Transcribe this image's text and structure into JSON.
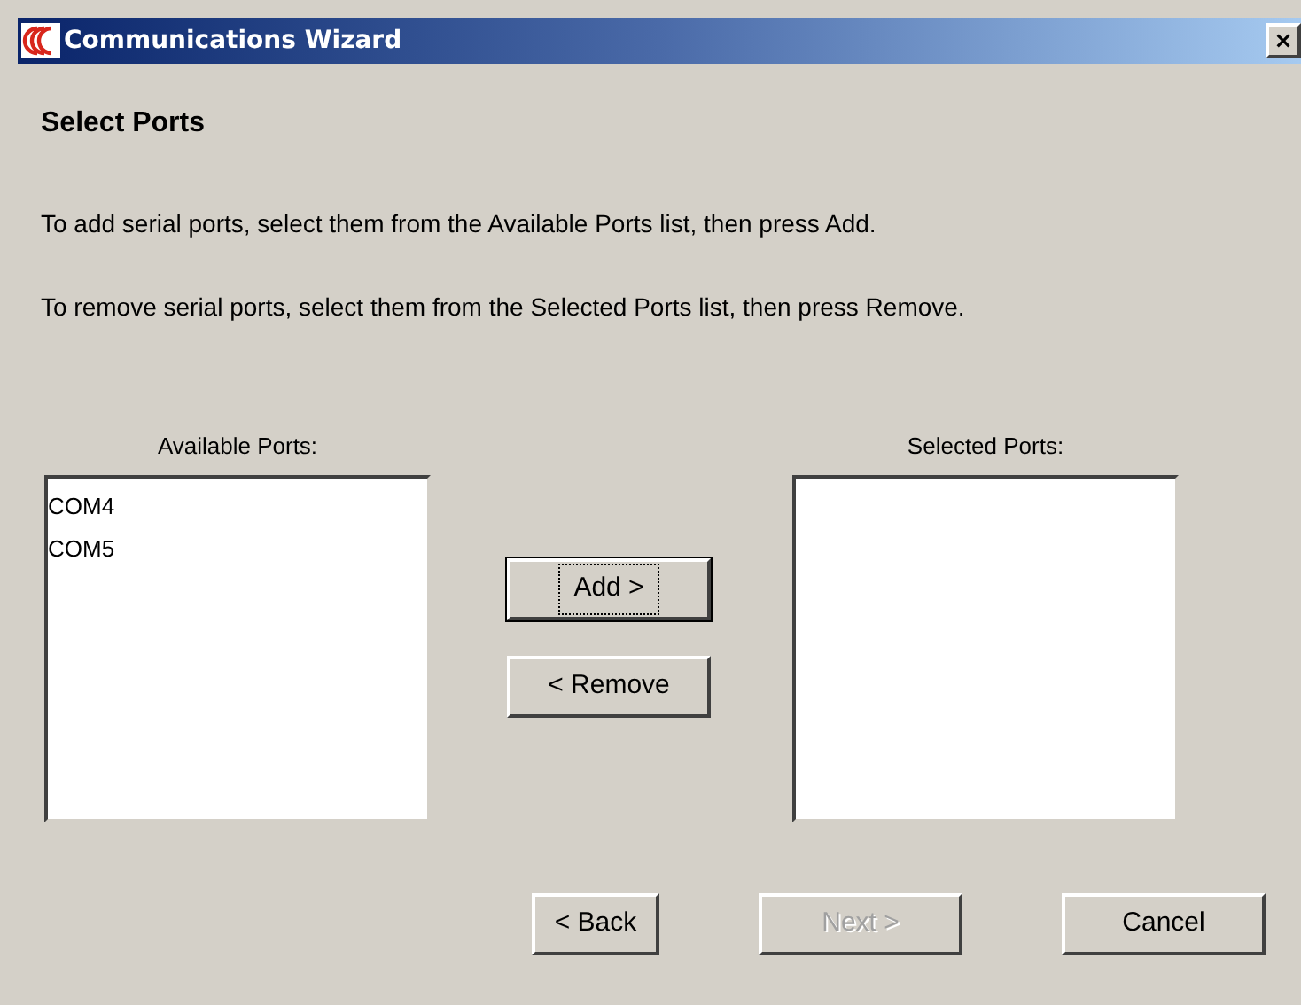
{
  "window": {
    "title": "Communications Wizard",
    "close": "×"
  },
  "heading": "Select Ports",
  "instructions": [
    "To add serial ports, select them from the Available Ports list, then press Add.",
    "To remove serial ports, select them from the Selected Ports list, then press Remove."
  ],
  "available": {
    "label": "Available Ports:",
    "items": [
      "COM4",
      "COM5"
    ]
  },
  "selected": {
    "label": "Selected Ports:"
  },
  "move_buttons": [
    {
      "label": "Add >",
      "focused": true,
      "disabled": false
    },
    {
      "label": "< Remove",
      "focused": false,
      "disabled": false
    }
  ],
  "nav_buttons": [
    {
      "label": "< Back",
      "disabled": false
    },
    {
      "label": "Next >",
      "disabled": true
    },
    {
      "label": "Cancel",
      "disabled": false
    }
  ]
}
